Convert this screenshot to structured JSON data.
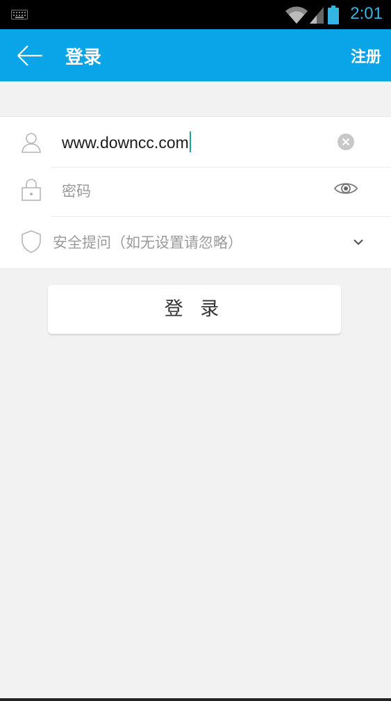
{
  "status_bar": {
    "time": "2:01",
    "icons": [
      "keyboard-icon",
      "wifi-icon",
      "signal-icon",
      "battery-icon"
    ]
  },
  "app_bar": {
    "title": "登录",
    "register_label": "注册",
    "back_icon": "back-arrow-icon",
    "background": "#0aa4e8"
  },
  "form": {
    "username": {
      "value": "www.downcc.com",
      "icon": "user-icon",
      "clear_icon": "clear-icon"
    },
    "password": {
      "placeholder": "密码",
      "icon": "lock-icon",
      "toggle_icon": "eye-icon"
    },
    "security_question": {
      "placeholder": "安全提问（如无设置请忽略）",
      "icon": "shield-icon",
      "dropdown_icon": "chevron-down-icon"
    }
  },
  "login_button": {
    "label": "登 录"
  },
  "colors": {
    "accent": "#0aa4e8",
    "caret": "#18a89a",
    "status_text": "#33b5e5"
  }
}
